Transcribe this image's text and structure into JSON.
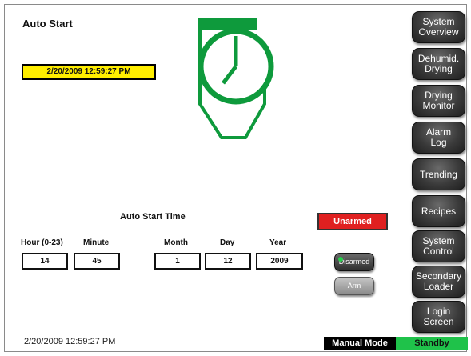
{
  "header": {
    "title": "Auto Start"
  },
  "current_datetime": "2/20/2009 12:59:27 PM",
  "auto_start": {
    "label": "Auto Start Time",
    "fields": [
      {
        "name": "hour",
        "label": "Hour (0-23)",
        "value": "14"
      },
      {
        "name": "minute",
        "label": "Minute",
        "value": "45"
      },
      {
        "name": "month",
        "label": "Month",
        "value": "1"
      },
      {
        "name": "day",
        "label": "Day",
        "value": "12"
      },
      {
        "name": "year",
        "label": "Year",
        "value": "2009"
      }
    ]
  },
  "arming": {
    "status": "Unarmed",
    "disarmed_label": "Disarmed",
    "arm_label": "Arm"
  },
  "nav": {
    "items": [
      {
        "name": "system-overview",
        "label": "System\nOverview"
      },
      {
        "name": "dehumid-drying",
        "label": "Dehumid.\nDrying"
      },
      {
        "name": "drying-monitor",
        "label": "Drying\nMonitor"
      },
      {
        "name": "alarm-log",
        "label": "Alarm\nLog"
      },
      {
        "name": "trending",
        "label": "Trending"
      },
      {
        "name": "recipes",
        "label": "Recipes"
      },
      {
        "name": "system-control",
        "label": "System\nControl"
      },
      {
        "name": "secondary-loader",
        "label": "Secondary\nLoader"
      },
      {
        "name": "login-screen",
        "label": "Login\nScreen"
      }
    ]
  },
  "footer": {
    "datetime": "2/20/2009 12:59:27 PM",
    "mode": "Manual Mode",
    "state": "Standby"
  },
  "colors": {
    "accent_green": "#0e9a3c",
    "status_green": "#1fc24a",
    "alarm_red": "#e02020",
    "highlight_yellow": "#ffee00"
  },
  "icons": {
    "hero": "auto-start-clock-icon"
  }
}
